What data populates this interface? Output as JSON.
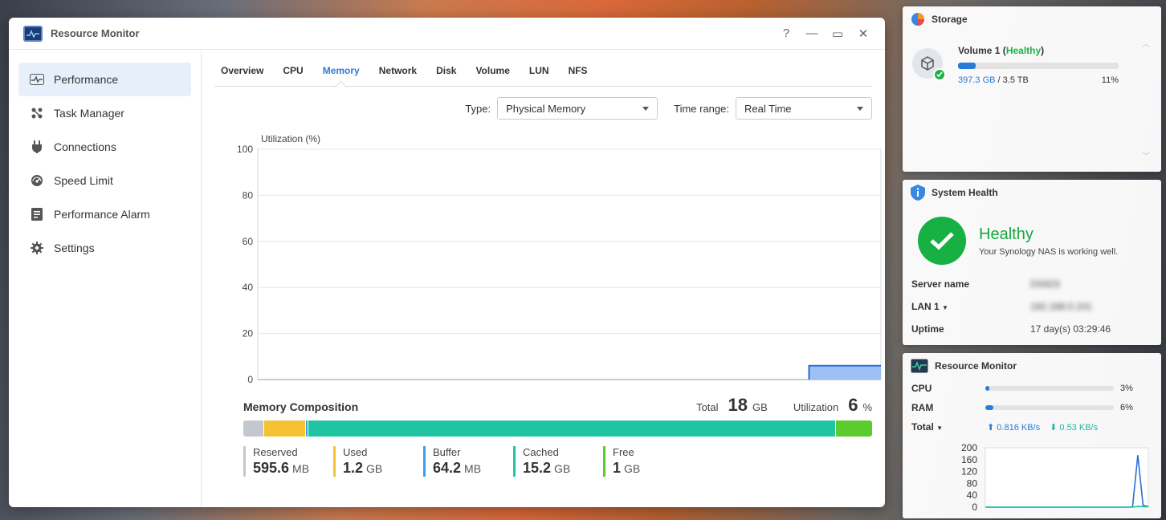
{
  "window": {
    "title": "Resource Monitor",
    "controls": {
      "help": "?",
      "minimize": "—",
      "maximize": "▭",
      "close": "✕"
    }
  },
  "sidebar": {
    "items": [
      {
        "label": "Performance",
        "icon": "performance-icon",
        "active": true
      },
      {
        "label": "Task Manager",
        "icon": "task-manager-icon"
      },
      {
        "label": "Connections",
        "icon": "plug-icon"
      },
      {
        "label": "Speed Limit",
        "icon": "gauge-icon"
      },
      {
        "label": "Performance Alarm",
        "icon": "alarm-icon"
      },
      {
        "label": "Settings",
        "icon": "gear-icon"
      }
    ]
  },
  "tabs": [
    {
      "label": "Overview"
    },
    {
      "label": "CPU"
    },
    {
      "label": "Memory",
      "active": true
    },
    {
      "label": "Network"
    },
    {
      "label": "Disk"
    },
    {
      "label": "Volume"
    },
    {
      "label": "LUN"
    },
    {
      "label": "NFS"
    }
  ],
  "filters": {
    "type_label": "Type:",
    "type_value": "Physical Memory",
    "time_label": "Time range:",
    "time_value": "Real Time"
  },
  "chart_data": {
    "type": "area",
    "title": "Utilization (%)",
    "ylim": [
      0,
      100
    ],
    "yticks": [
      0,
      20,
      40,
      60,
      80,
      100
    ],
    "grid": true,
    "series": [
      {
        "values": [
          0,
          0,
          0,
          0,
          0,
          0,
          0,
          0,
          0,
          0,
          0,
          0,
          0,
          0,
          0,
          0,
          0,
          0,
          0,
          0,
          0,
          0,
          0,
          0,
          0,
          0,
          0,
          0,
          0,
          0,
          0,
          0,
          0,
          0,
          0,
          0,
          0,
          0,
          0,
          0,
          0,
          0,
          0,
          0,
          0,
          0,
          6,
          6,
          6,
          6,
          6,
          6,
          6
        ],
        "color": "#2b6fd6",
        "fill": "#9ec1f5"
      }
    ]
  },
  "composition": {
    "title": "Memory Composition",
    "total_label": "Total",
    "total_value": "18",
    "total_unit": "GB",
    "util_label": "Utilization",
    "util_value": "6",
    "util_unit": "%",
    "segments": [
      {
        "label": "Reserved",
        "value": "595.6",
        "unit": "MB",
        "color": "#c3c8cf",
        "share": 3.3
      },
      {
        "label": "Used",
        "value": "1.2",
        "unit": "GB",
        "color": "#f6c231",
        "share": 6.7
      },
      {
        "label": "Buffer",
        "value": "64.2",
        "unit": "MB",
        "color": "#3a9ef0",
        "share": 0.4
      },
      {
        "label": "Cached",
        "value": "15.2",
        "unit": "GB",
        "color": "#1fc5a2",
        "share": 83.9
      },
      {
        "label": "Free",
        "value": "1",
        "unit": "GB",
        "color": "#5ccb2e",
        "share": 5.7
      }
    ]
  },
  "storage": {
    "title": "Storage",
    "volume_name": "Volume 1",
    "volume_status": "Healthy",
    "used": "397.3 GB",
    "total": "/ 3.5 TB",
    "percent_text": "11%",
    "percent": 11
  },
  "health": {
    "title": "System Health",
    "status": "Healthy",
    "message": "Your Synology NAS is working well.",
    "rows": [
      {
        "key": "Server name",
        "value": "DS923"
      },
      {
        "key": "LAN 1",
        "value": "192.168.0.101"
      },
      {
        "key": "Uptime",
        "value": "17 day(s) 03:29:46"
      }
    ]
  },
  "monitor": {
    "title": "Resource Monitor",
    "cpu_label": "CPU",
    "cpu_text": "3%",
    "cpu": 3,
    "ram_label": "RAM",
    "ram_text": "6%",
    "ram": 6,
    "total_label": "Total",
    "upload": "0.816 KB/s",
    "download": "0.53 KB/s",
    "chart_data": {
      "type": "line",
      "ylim": [
        0,
        200
      ],
      "yticks": [
        "200",
        "160",
        "120",
        "80",
        "40",
        "0"
      ],
      "series": [
        {
          "values": [
            0,
            0,
            0,
            0,
            0,
            0,
            0,
            0,
            0,
            0,
            0,
            0,
            0,
            0,
            0,
            0,
            0,
            0,
            0,
            0,
            0,
            0,
            0,
            0,
            0,
            0,
            0,
            0,
            1,
            175,
            6,
            2
          ],
          "color": "#2b6fd6"
        },
        {
          "values": [
            0,
            0,
            0,
            0,
            0,
            0,
            0,
            0,
            0,
            0,
            0,
            0,
            0,
            0,
            0,
            0,
            0,
            0,
            0,
            0,
            0,
            0,
            0,
            0,
            0,
            0,
            0,
            0,
            0,
            3,
            2,
            1
          ],
          "color": "#1fc5a2"
        }
      ]
    }
  }
}
